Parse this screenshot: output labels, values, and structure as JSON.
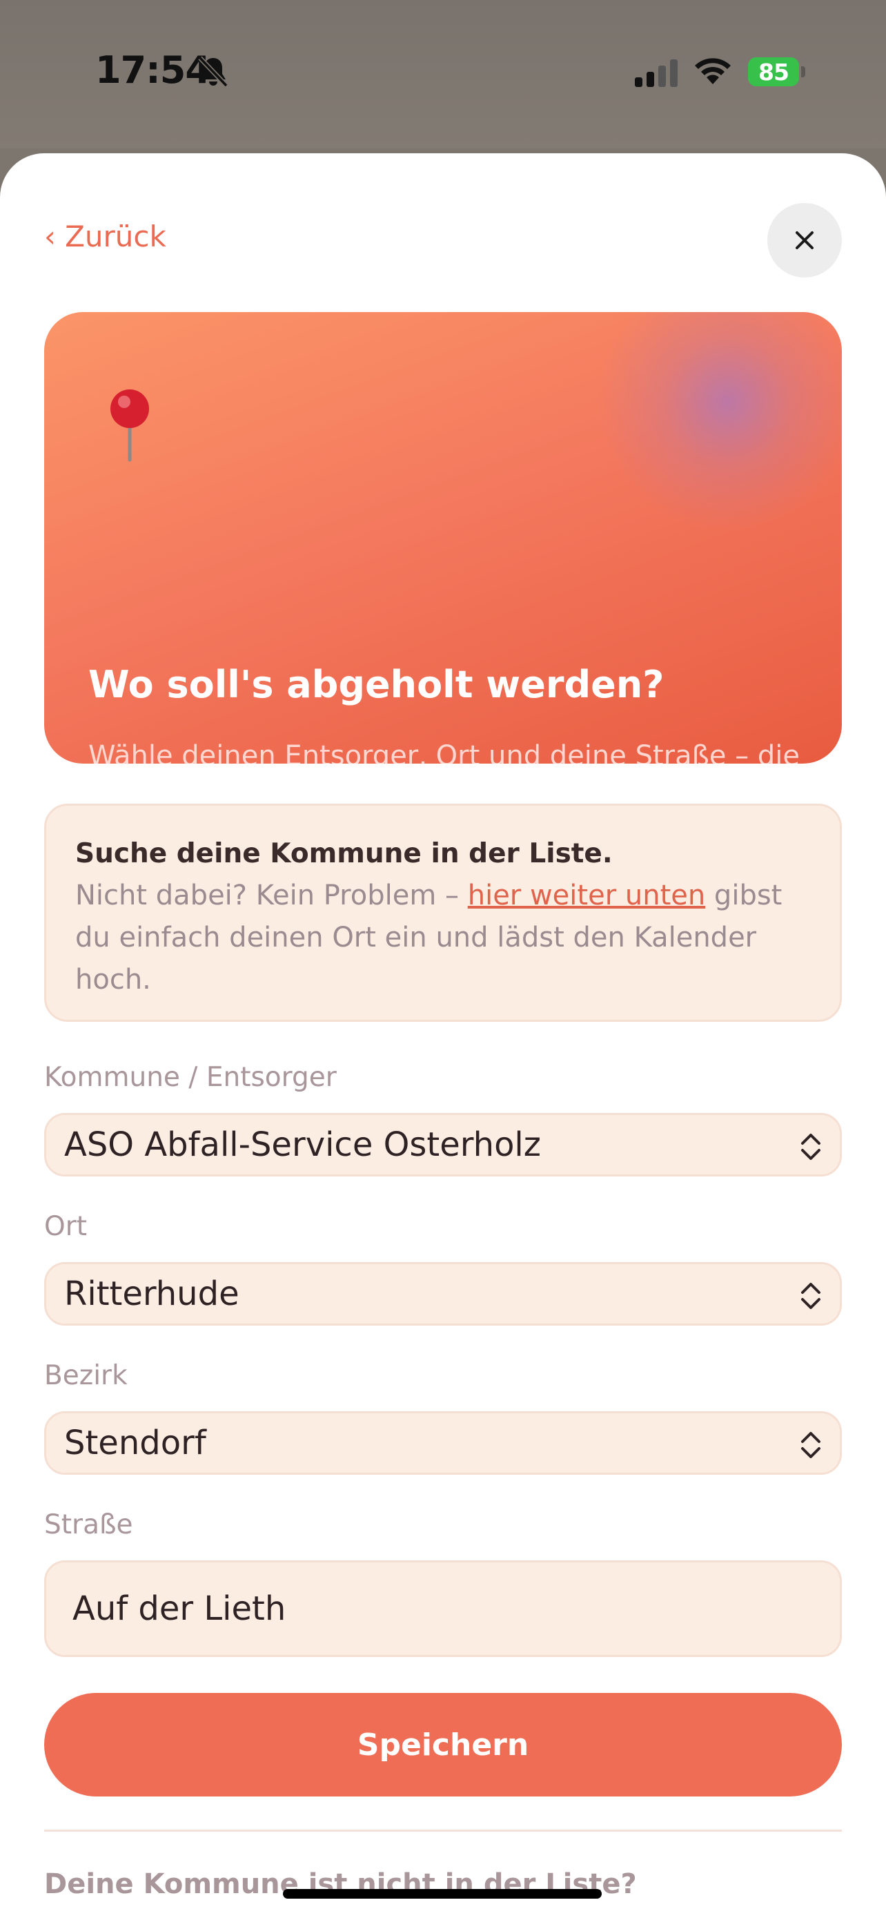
{
  "status_bar": {
    "time": "17:54",
    "battery": "85",
    "icons": [
      "bell-slash-icon",
      "signal-icon",
      "wifi-icon",
      "battery-charging-icon"
    ]
  },
  "nav": {
    "back_label": "‹ Zurück",
    "close_icon": "close-icon"
  },
  "hero": {
    "icon": "pushpin-icon",
    "title": "Wo soll's abgeholt werden?",
    "text": "Wähle deinen Entsorger, Ort und deine Straße – die Termine kommen direkt von der offiziellen Schnittstelle."
  },
  "info": {
    "title": "Suche deine Kommune in der Liste.",
    "text_before": "Nicht dabei? Kein Problem – ",
    "link": "hier weiter unten",
    "text_after": " gibst du einfach deinen Ort ein und lädst den Kalender hoch."
  },
  "form": {
    "kommune_label": "Kommune / Entsorger",
    "kommune_value": "ASO Abfall-Service Osterholz",
    "ort_label": "Ort",
    "ort_value": "Ritterhude",
    "bezirk_label": "Bezirk",
    "bezirk_value": "Stendorf",
    "strasse_label": "Straße",
    "strasse_value": "Auf der Lieth",
    "save_label": "Speichern"
  },
  "footer": {
    "not_in_list": "Deine Kommune ist nicht in der Liste?"
  },
  "colors": {
    "accent": "#ef6c55",
    "field_bg": "#fcede3"
  }
}
